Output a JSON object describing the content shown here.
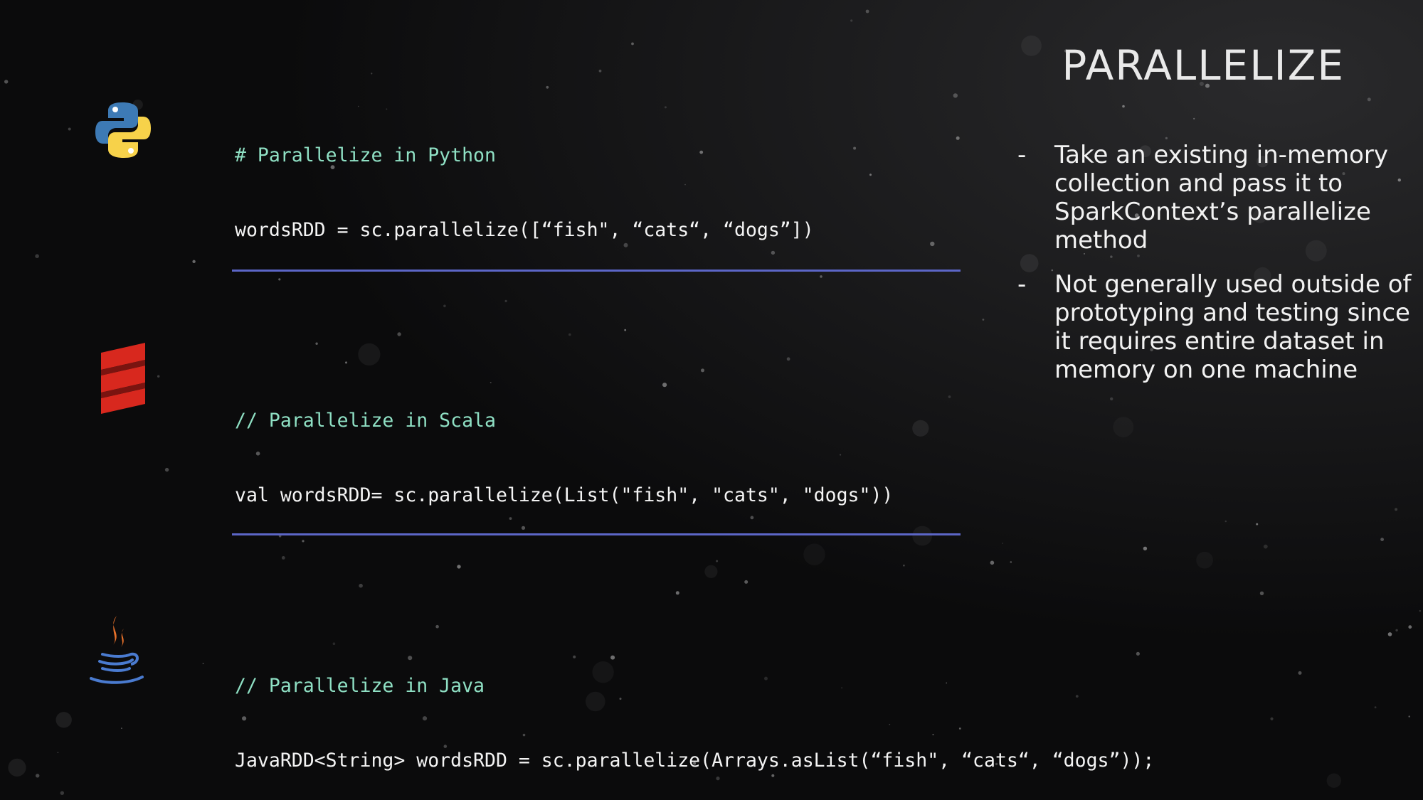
{
  "slide": {
    "title": "PARALLELIZE"
  },
  "examples": [
    {
      "icon": "python-logo-icon",
      "comment": "# Parallelize in Python",
      "code": "wordsRDD = sc.parallelize([“fish\", “cats“, “dogs”])"
    },
    {
      "icon": "scala-logo-icon",
      "comment": "// Parallelize in Scala",
      "code": "val wordsRDD= sc.parallelize(List(\"fish\", \"cats\", \"dogs\"))"
    },
    {
      "icon": "java-logo-icon",
      "comment": "// Parallelize in Java",
      "code": "JavaRDD<String> wordsRDD = sc.parallelize(Arrays.asList(“fish\", “cats“, “dogs”));"
    }
  ],
  "bullets": [
    {
      "dash": "-",
      "text": "Take an existing in-memory collection and pass it to SparkContext’s parallelize method"
    },
    {
      "dash": "-",
      "text": "Not generally used outside of prototyping and testing since it requires entire dataset in memory on one machine"
    }
  ],
  "colors": {
    "background": "#0b0b0c",
    "comment": "#8fe0c4",
    "code": "#f4f4f4",
    "divider": "#5c66c7"
  }
}
